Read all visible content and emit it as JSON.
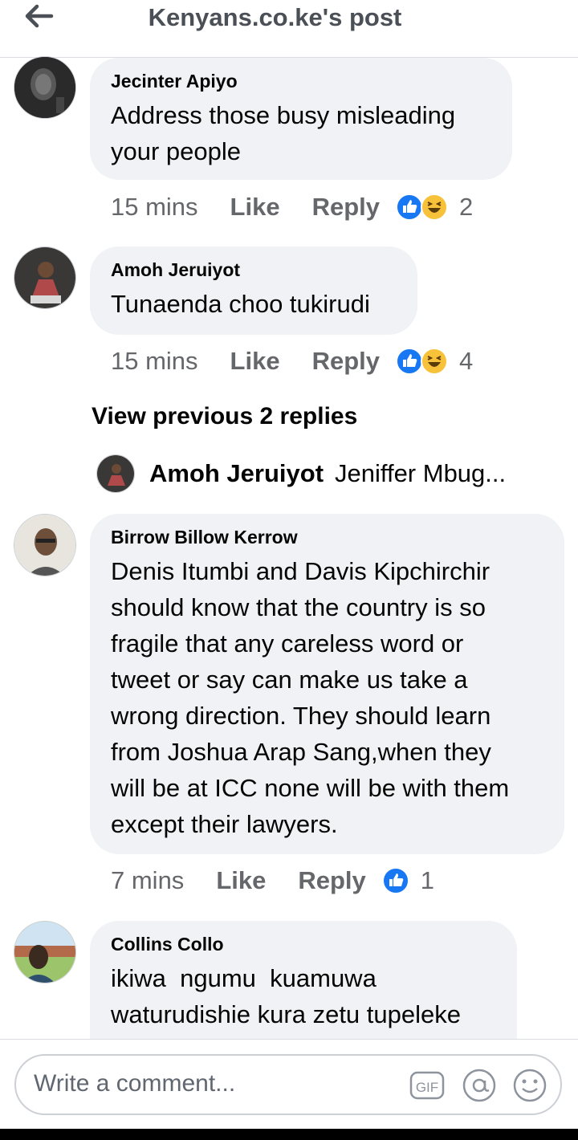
{
  "header": {
    "title": "Kenyans.co.ke's post",
    "back_icon": "arrow-left-icon"
  },
  "comments": [
    {
      "author": "Jecinter Apiyo",
      "text": [
        "Address those busy misleading",
        "your people"
      ],
      "time": "15 mins",
      "like_label": "Like",
      "reply_label": "Reply",
      "reactions": [
        "like",
        "haha"
      ],
      "reaction_count": "2"
    },
    {
      "author": "Amoh Jeruiyot",
      "text": [
        "Tunaenda choo tukirudi"
      ],
      "time": "15 mins",
      "like_label": "Like",
      "reply_label": "Reply",
      "reactions": [
        "like",
        "haha"
      ],
      "reaction_count": "4"
    },
    {
      "author": "Birrow Billow Kerrow",
      "text": [
        "Denis Itumbi and Davis Kipchirchir",
        "should know that the country is so",
        "fragile that any careless word or",
        "tweet or say can make us take a",
        "wrong direction. They should learn",
        "from Joshua Arap Sang,when they",
        "will be at ICC none will be with them",
        "except their lawyers."
      ],
      "time": "7 mins",
      "like_label": "Like",
      "reply_label": "Reply",
      "reactions": [
        "like"
      ],
      "reaction_count": "1"
    },
    {
      "author": "Collins Collo",
      "text": [
        "ikiwa  ngumu  kuamuwa",
        "waturudishie kura zetu tupeleke"
      ]
    }
  ],
  "view_previous": "View previous 2 replies",
  "reply_preview": {
    "author": "Amoh Jeruiyot",
    "text": "Jeniffer Mbug..."
  },
  "composer": {
    "placeholder": "Write a comment...",
    "gif_label": "GIF"
  },
  "colors": {
    "like_blue": "#1877f2",
    "haha_yellow": "#f7c23a",
    "bubble_bg": "#f0f2f5",
    "meta_gray": "#65676b"
  }
}
